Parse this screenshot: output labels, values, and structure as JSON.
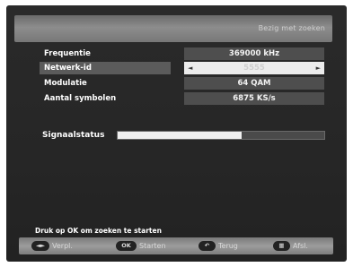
{
  "header": {
    "status": "Bezig met zoeken"
  },
  "settings": [
    {
      "label": "Frequentie",
      "value": "369000 kHz"
    },
    {
      "label": "Netwerk-id",
      "value": "5555"
    },
    {
      "label": "Modulatie",
      "value": "64 QAM"
    },
    {
      "label": "Aantal symbolen",
      "value": "6875 KS/s"
    }
  ],
  "signal": {
    "label": "Signaalstatus",
    "level_percent": 60
  },
  "hint": "Druk op OK om zoeken te starten",
  "footer": [
    {
      "key": "◄►",
      "label": "Verpl."
    },
    {
      "key": "OK",
      "label": "Starten"
    },
    {
      "key": "↶",
      "label": "Terug"
    },
    {
      "key": "▦",
      "label": "Afsl."
    }
  ],
  "colors": {
    "panel": "#262626",
    "bar": "#8d8d8d",
    "selected": "#ececec",
    "signal_fill": "#f0f0f0"
  }
}
